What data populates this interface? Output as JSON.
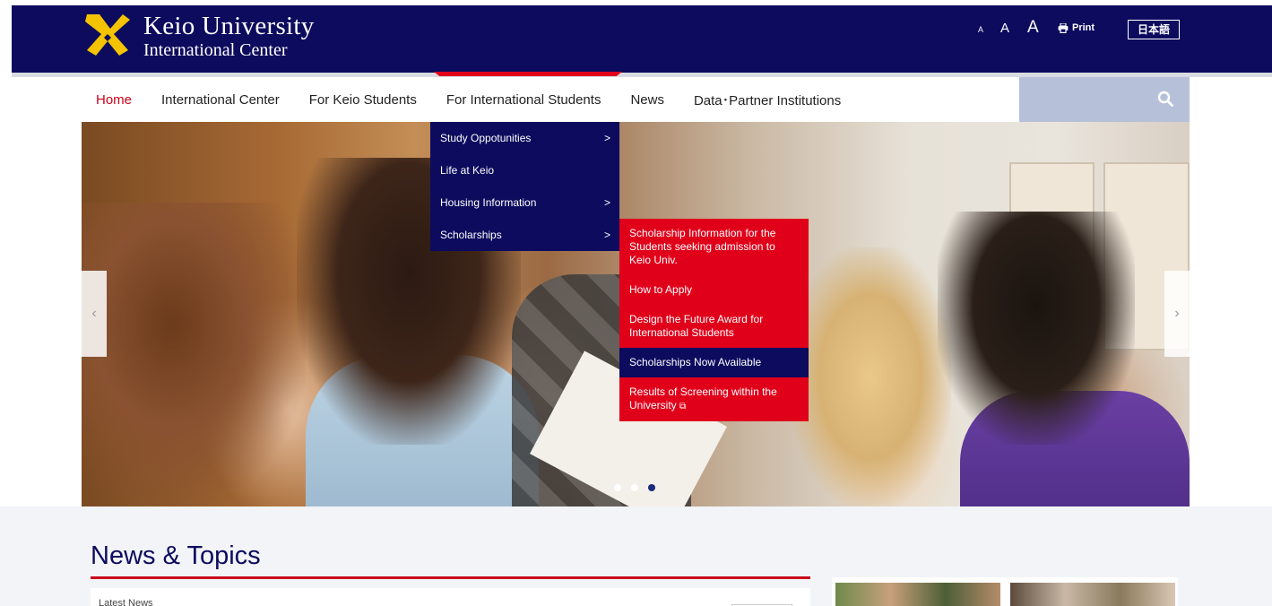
{
  "header": {
    "logo_line1": "Keio University",
    "logo_line2": "International Center",
    "font_small": "A",
    "font_mid": "A",
    "font_large": "A",
    "print_label": "Print",
    "lang_label": "日本語",
    "brand_color": "#0c0b5e",
    "logo_color": "#f5c400"
  },
  "nav": {
    "items": [
      {
        "label": "Home"
      },
      {
        "label": "International Center"
      },
      {
        "label": "For Keio Students"
      },
      {
        "label": "For International Students"
      },
      {
        "label": "News"
      },
      {
        "label": "Data･Partner Institutions"
      }
    ],
    "active_color": "#d0021b",
    "search_icon": "search-icon"
  },
  "dropdown": {
    "items": [
      {
        "label": "Study Oppotunities",
        "arrow": ">"
      },
      {
        "label": "Life at Keio",
        "arrow": ""
      },
      {
        "label": "Housing Information",
        "arrow": ">"
      },
      {
        "label": "Scholarships",
        "arrow": ">"
      }
    ]
  },
  "submenu": {
    "items": [
      {
        "label": "Scholarship Information for the Students seeking admission to Keio Univ."
      },
      {
        "label": "How to Apply"
      },
      {
        "label": "Design the Future Award for International Students"
      },
      {
        "label": "Scholarships Now Available"
      },
      {
        "label": "Results of Screening within the University"
      }
    ],
    "accent": "#e0001a"
  },
  "hero": {
    "prev_arrow": "‹",
    "next_arrow": "›"
  },
  "news": {
    "title": "News & Topics",
    "latest_label": "Latest News"
  }
}
